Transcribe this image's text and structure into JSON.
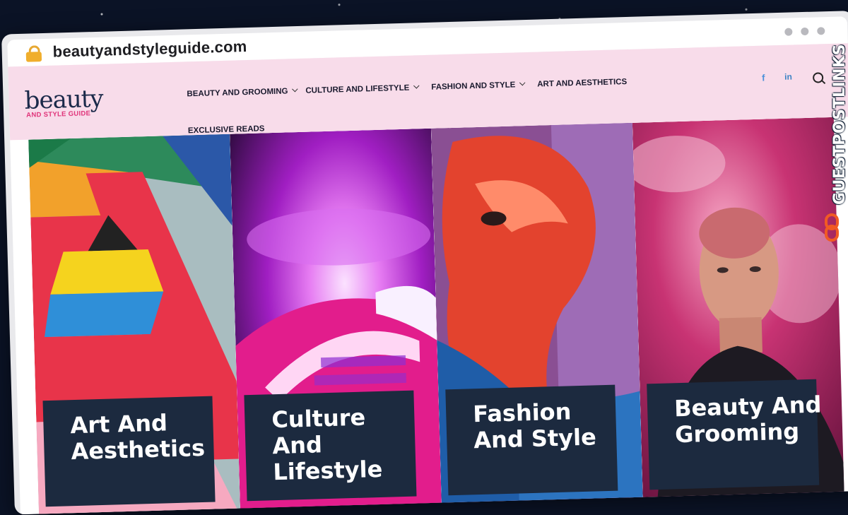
{
  "browser": {
    "url": "beautyandstyleguide.com",
    "lock_icon": "lock-icon",
    "window_dots": 3
  },
  "site": {
    "logo": {
      "main": "beauty",
      "sub": "AND STYLE GUIDE"
    },
    "nav": [
      {
        "label": "BEAUTY AND GROOMING",
        "has_dropdown": true
      },
      {
        "label": "CULTURE AND LIFESTYLE",
        "has_dropdown": true
      },
      {
        "label": "FASHION AND STYLE",
        "has_dropdown": true
      },
      {
        "label": "ART AND AESTHETICS",
        "has_dropdown": false
      },
      {
        "label": "EXCLUSIVE READS",
        "has_dropdown": false
      }
    ],
    "social": {
      "facebook": "f",
      "linkedin": "in"
    },
    "search_icon": "search-icon",
    "colors": {
      "header_bg": "#f8dcea",
      "label_bg": "#1c2a3f",
      "logo_pink": "#e0347a",
      "logo_navy": "#1b2a4a"
    }
  },
  "panels": [
    {
      "title": "Art And Aesthetics"
    },
    {
      "title": "Culture And Lifestyle"
    },
    {
      "title": "Fashion And Style"
    },
    {
      "title": "Beauty And Grooming"
    }
  ],
  "watermark": {
    "text": "GUESTPOSTLINKS"
  }
}
